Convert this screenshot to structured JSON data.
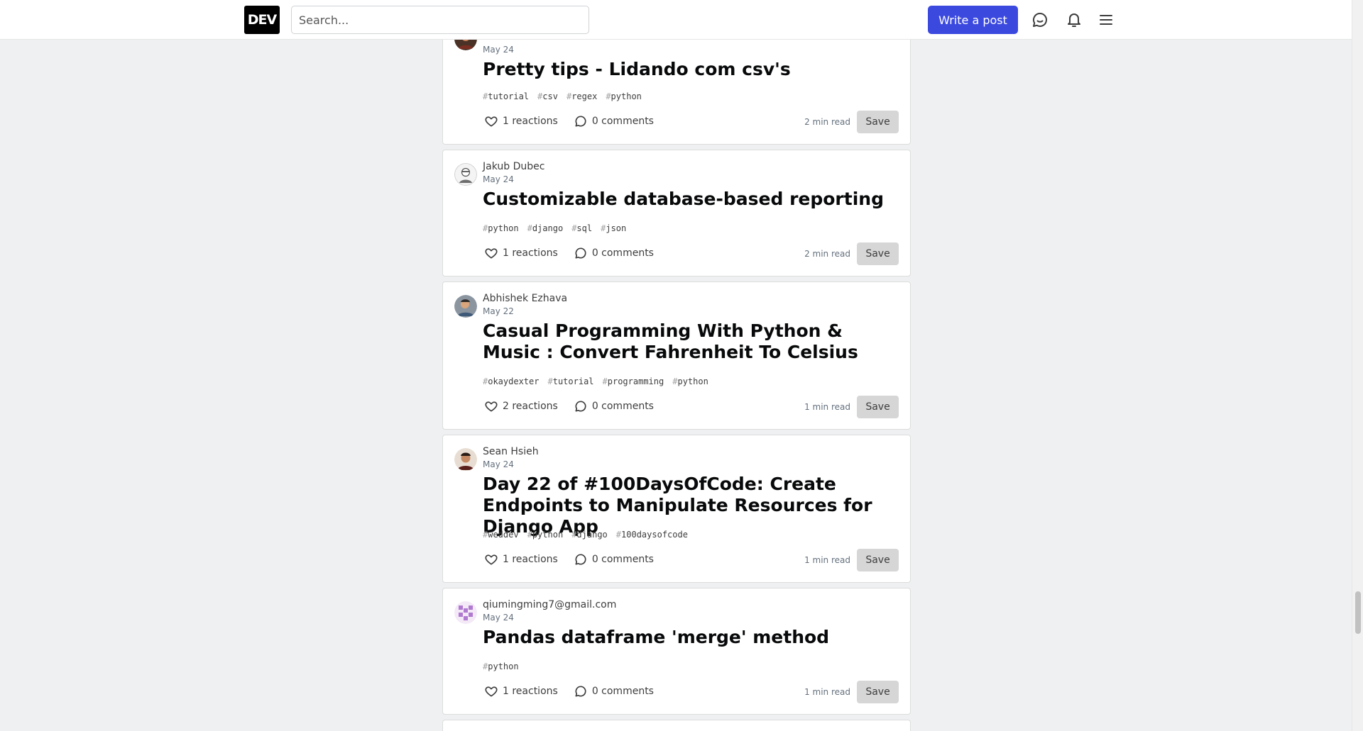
{
  "header": {
    "logo_text": "DEV",
    "search_placeholder": "Search...",
    "write_post_label": "Write a post",
    "icons": [
      "chat-icon",
      "bell-icon",
      "menu-icon"
    ]
  },
  "posts": [
    {
      "author": "",
      "date": "May 24",
      "title": "Pretty tips - Lidando com csv's",
      "tags": [
        "tutorial",
        "csv",
        "regex",
        "python"
      ],
      "reactions": "1 reactions",
      "comments": "0 comments",
      "read_time": "2 min read",
      "save_label": "Save"
    },
    {
      "author": "Jakub Dubec",
      "date": "May 24",
      "title": "Customizable database-based reporting",
      "tags": [
        "python",
        "django",
        "sql",
        "json"
      ],
      "reactions": "1 reactions",
      "comments": "0 comments",
      "read_time": "2 min read",
      "save_label": "Save"
    },
    {
      "author": "Abhishek Ezhava",
      "date": "May 22",
      "title": "Casual Programming With Python & Music : Convert Fahrenheit To Celsius",
      "tags": [
        "okaydexter",
        "tutorial",
        "programming",
        "python"
      ],
      "reactions": "2 reactions",
      "comments": "0 comments",
      "read_time": "1 min read",
      "save_label": "Save"
    },
    {
      "author": "Sean Hsieh",
      "date": "May 24",
      "title": "Day 22 of #100DaysOfCode: Create Endpoints to Manipulate Resources for Django App",
      "tags": [
        "weddev",
        "python",
        "django",
        "100daysofcode"
      ],
      "reactions": "1 reactions",
      "comments": "0 comments",
      "read_time": "1 min read",
      "save_label": "Save"
    },
    {
      "author": "qiumingming7@gmail.com",
      "date": "May 24",
      "title": "Pandas dataframe 'merge' method",
      "tags": [
        "python"
      ],
      "reactions": "1 reactions",
      "comments": "0 comments",
      "read_time": "1 min read",
      "save_label": "Save"
    }
  ]
}
